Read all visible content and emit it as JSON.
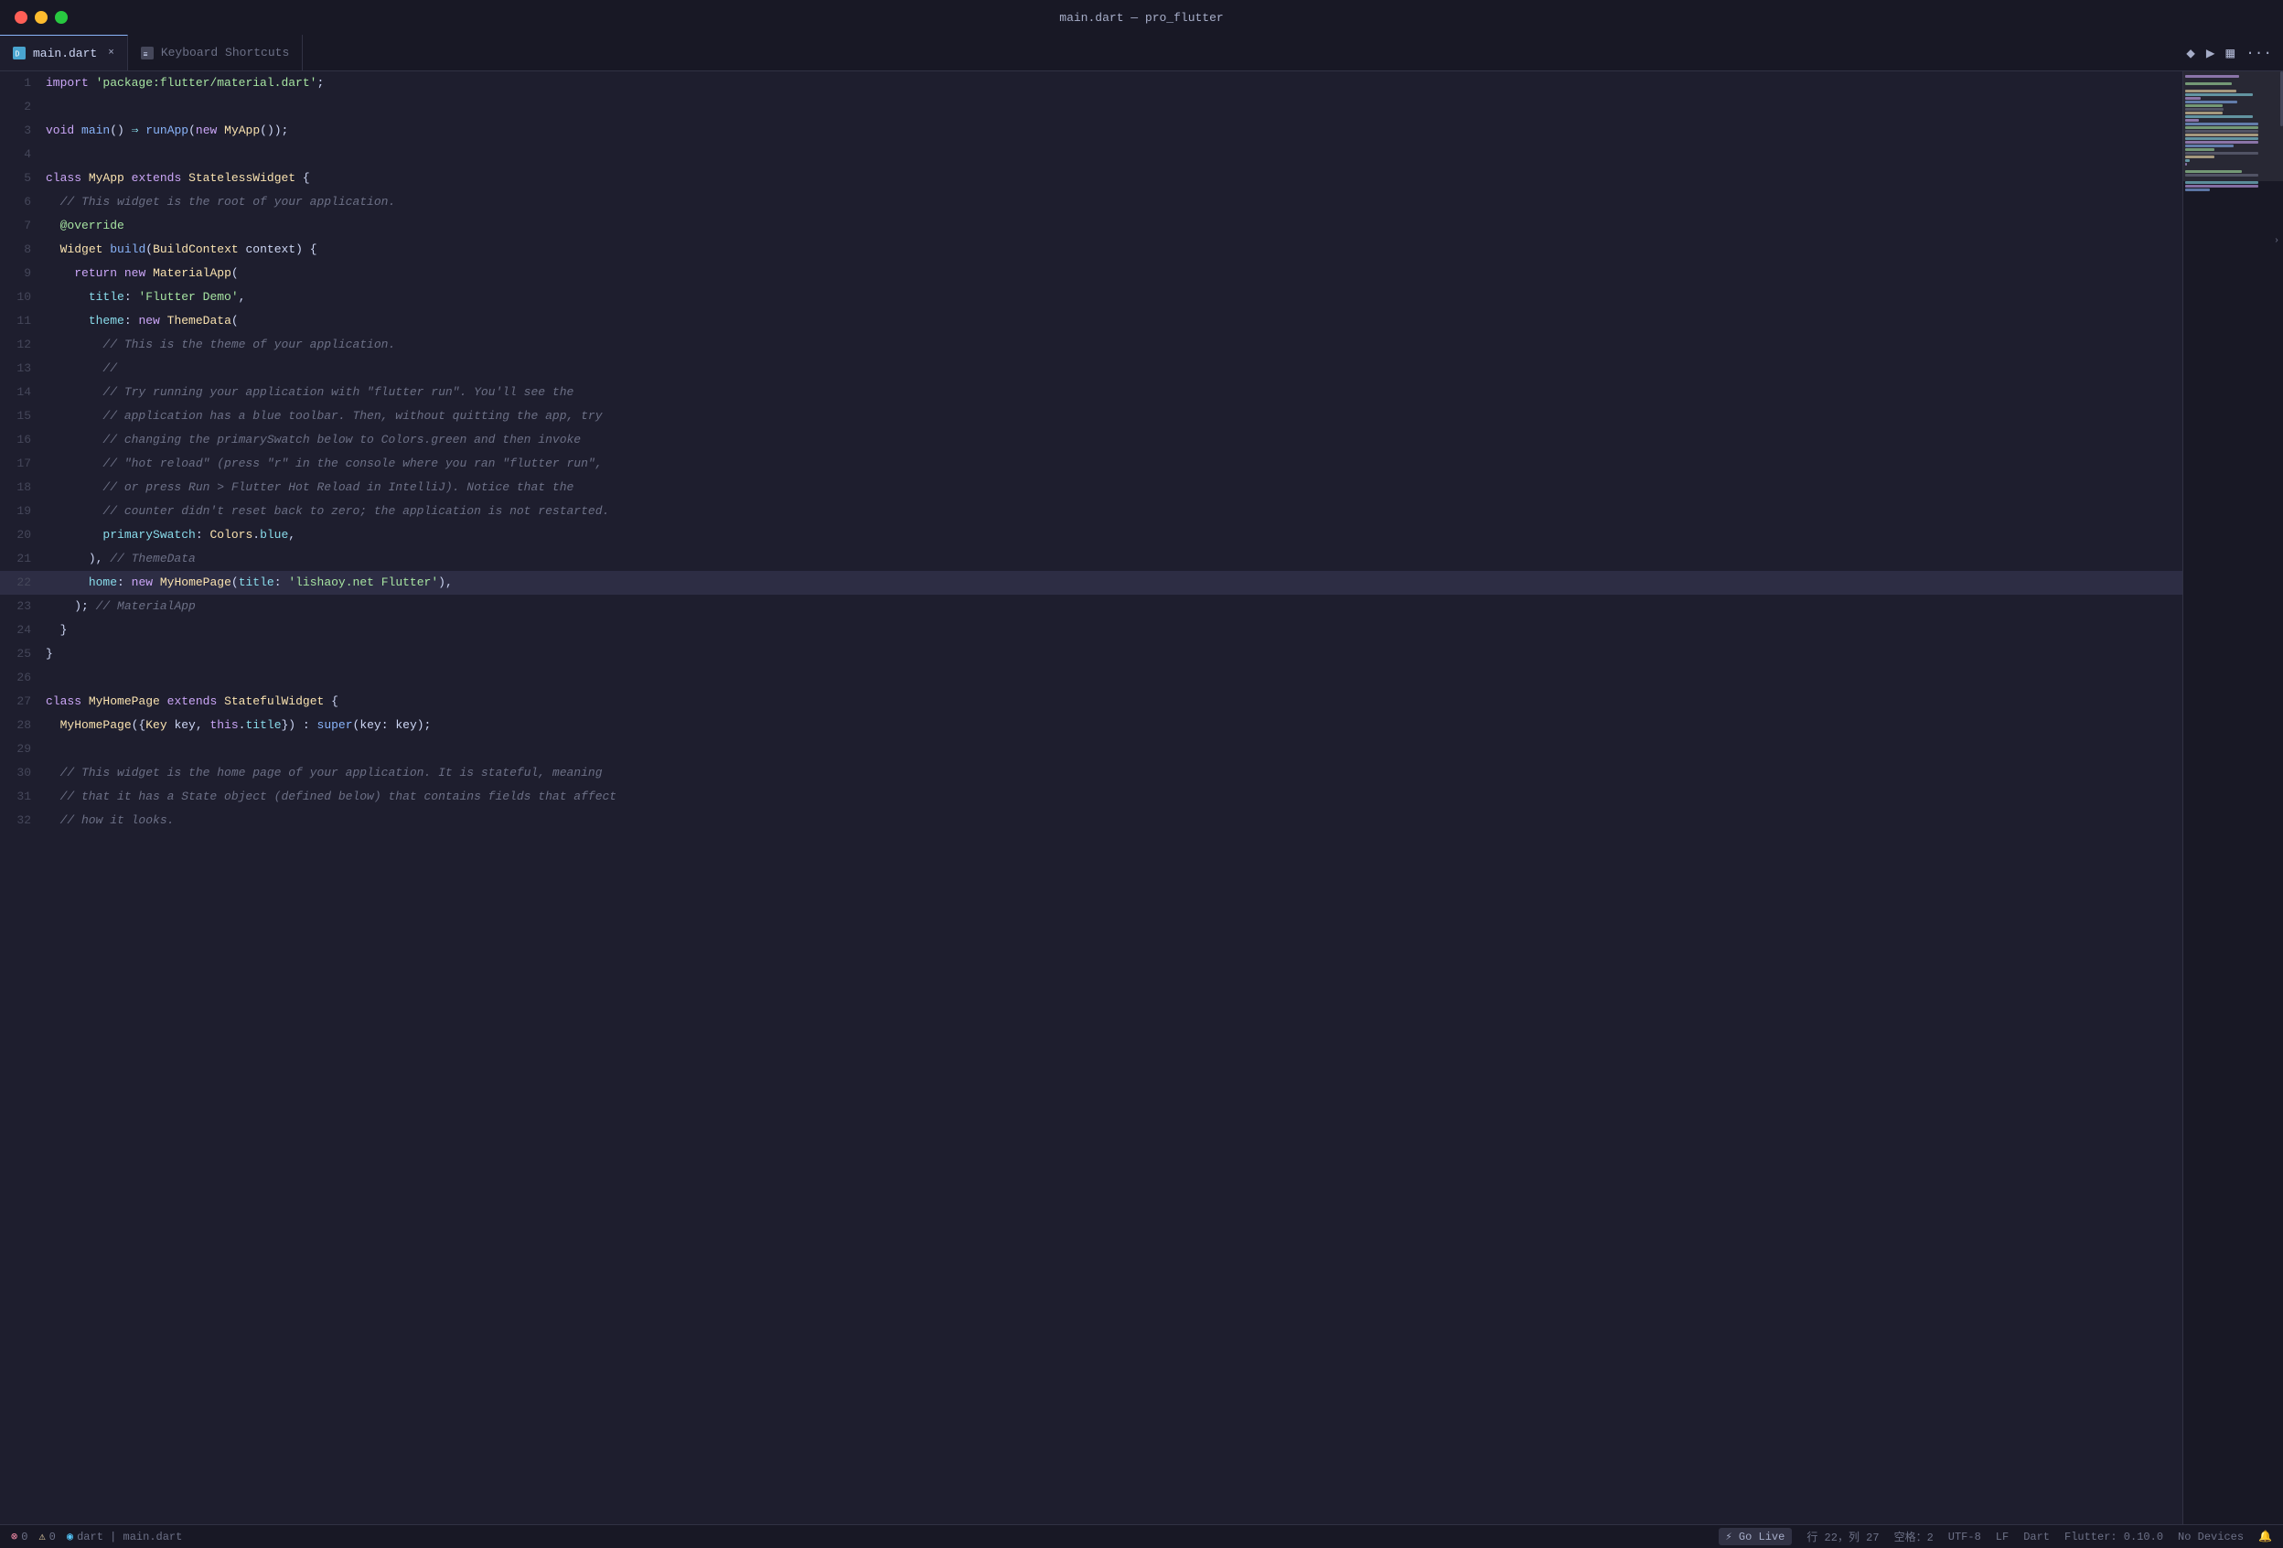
{
  "window": {
    "title": "main.dart — pro_flutter"
  },
  "tabs": [
    {
      "id": "main-dart",
      "label": "main.dart",
      "icon": "dart",
      "active": true,
      "closable": true
    },
    {
      "id": "keyboard-shortcuts",
      "label": "Keyboard Shortcuts",
      "icon": "doc",
      "active": false,
      "closable": false
    }
  ],
  "toolbar": {
    "git_icon": "◆",
    "run_icon": "▶",
    "layout_icon": "▦",
    "more_icon": "···"
  },
  "code_lines": [
    {
      "n": 1,
      "tokens": [
        {
          "t": "kw",
          "v": "import"
        },
        {
          "t": "var",
          "v": " "
        },
        {
          "t": "str",
          "v": "'package:flutter/material.dart'"
        },
        {
          "t": "punct",
          "v": ";"
        }
      ]
    },
    {
      "n": 2,
      "tokens": []
    },
    {
      "n": 3,
      "tokens": [
        {
          "t": "kw",
          "v": "void"
        },
        {
          "t": "var",
          "v": " "
        },
        {
          "t": "fn",
          "v": "main"
        },
        {
          "t": "punct",
          "v": "() "
        },
        {
          "t": "op",
          "v": "⇒"
        },
        {
          "t": "var",
          "v": " "
        },
        {
          "t": "fn",
          "v": "runApp"
        },
        {
          "t": "punct",
          "v": "("
        },
        {
          "t": "kw",
          "v": "new"
        },
        {
          "t": "var",
          "v": " "
        },
        {
          "t": "cls",
          "v": "MyApp"
        },
        {
          "t": "punct",
          "v": "());"
        }
      ]
    },
    {
      "n": 4,
      "tokens": []
    },
    {
      "n": 5,
      "tokens": [
        {
          "t": "kw",
          "v": "class"
        },
        {
          "t": "var",
          "v": " "
        },
        {
          "t": "cls",
          "v": "MyApp"
        },
        {
          "t": "var",
          "v": " "
        },
        {
          "t": "kw",
          "v": "extends"
        },
        {
          "t": "var",
          "v": " "
        },
        {
          "t": "cls",
          "v": "StatelessWidget"
        },
        {
          "t": "var",
          "v": " "
        },
        {
          "t": "punct",
          "v": "{"
        }
      ]
    },
    {
      "n": 6,
      "tokens": [
        {
          "t": "comment",
          "v": "  // This widget is the root of your application."
        }
      ]
    },
    {
      "n": 7,
      "tokens": [
        {
          "t": "decorator",
          "v": "  @override"
        }
      ]
    },
    {
      "n": 8,
      "tokens": [
        {
          "t": "var",
          "v": "  "
        },
        {
          "t": "cls",
          "v": "Widget"
        },
        {
          "t": "var",
          "v": " "
        },
        {
          "t": "fn",
          "v": "build"
        },
        {
          "t": "punct",
          "v": "("
        },
        {
          "t": "cls",
          "v": "BuildContext"
        },
        {
          "t": "var",
          "v": " context"
        },
        {
          "t": "punct",
          "v": ") {"
        }
      ]
    },
    {
      "n": 9,
      "tokens": [
        {
          "t": "var",
          "v": "    "
        },
        {
          "t": "kw",
          "v": "return"
        },
        {
          "t": "var",
          "v": " "
        },
        {
          "t": "kw",
          "v": "new"
        },
        {
          "t": "var",
          "v": " "
        },
        {
          "t": "cls",
          "v": "MaterialApp"
        },
        {
          "t": "punct",
          "v": "("
        }
      ]
    },
    {
      "n": 10,
      "tokens": [
        {
          "t": "var",
          "v": "      "
        },
        {
          "t": "prop",
          "v": "title"
        },
        {
          "t": "punct",
          "v": ": "
        },
        {
          "t": "str",
          "v": "'Flutter Demo'"
        },
        {
          "t": "punct",
          "v": ","
        }
      ]
    },
    {
      "n": 11,
      "tokens": [
        {
          "t": "var",
          "v": "      "
        },
        {
          "t": "prop",
          "v": "theme"
        },
        {
          "t": "punct",
          "v": ": "
        },
        {
          "t": "kw",
          "v": "new"
        },
        {
          "t": "var",
          "v": " "
        },
        {
          "t": "cls",
          "v": "ThemeData"
        },
        {
          "t": "punct",
          "v": "("
        }
      ]
    },
    {
      "n": 12,
      "tokens": [
        {
          "t": "comment",
          "v": "        // This is the theme of your application."
        }
      ]
    },
    {
      "n": 13,
      "tokens": [
        {
          "t": "comment",
          "v": "        //"
        }
      ]
    },
    {
      "n": 14,
      "tokens": [
        {
          "t": "comment",
          "v": "        // Try running your application with \"flutter run\". You'll see the"
        }
      ]
    },
    {
      "n": 15,
      "tokens": [
        {
          "t": "comment",
          "v": "        // application has a blue toolbar. Then, without quitting the app, try"
        }
      ]
    },
    {
      "n": 16,
      "tokens": [
        {
          "t": "comment",
          "v": "        // changing the primarySwatch below to Colors.green and then invoke"
        }
      ]
    },
    {
      "n": 17,
      "tokens": [
        {
          "t": "comment",
          "v": "        // \"hot reload\" (press \"r\" in the console where you ran \"flutter run\","
        }
      ]
    },
    {
      "n": 18,
      "tokens": [
        {
          "t": "comment",
          "v": "        // or press Run > Flutter Hot Reload in IntelliJ). Notice that the"
        }
      ]
    },
    {
      "n": 19,
      "tokens": [
        {
          "t": "comment",
          "v": "        // counter didn't reset back to zero; the application is not restarted."
        }
      ]
    },
    {
      "n": 20,
      "tokens": [
        {
          "t": "var",
          "v": "        "
        },
        {
          "t": "prop",
          "v": "primarySwatch"
        },
        {
          "t": "punct",
          "v": ": "
        },
        {
          "t": "cls",
          "v": "Colors"
        },
        {
          "t": "punct",
          "v": "."
        },
        {
          "t": "prop",
          "v": "blue"
        },
        {
          "t": "punct",
          "v": ","
        }
      ]
    },
    {
      "n": 21,
      "tokens": [
        {
          "t": "var",
          "v": "      "
        },
        {
          "t": "punct",
          "v": "), "
        },
        {
          "t": "comment",
          "v": "// ThemeData"
        }
      ]
    },
    {
      "n": 22,
      "tokens": [
        {
          "t": "var",
          "v": "      "
        },
        {
          "t": "prop",
          "v": "home"
        },
        {
          "t": "punct",
          "v": ": "
        },
        {
          "t": "kw",
          "v": "new"
        },
        {
          "t": "var",
          "v": " "
        },
        {
          "t": "cls",
          "v": "MyHomePage"
        },
        {
          "t": "punct",
          "v": "("
        },
        {
          "t": "prop",
          "v": "title"
        },
        {
          "t": "punct",
          "v": ": "
        },
        {
          "t": "str",
          "v": "'lishaoy.net Flutter'"
        },
        {
          "t": "punct",
          "v": "),"
        }
      ],
      "active": true
    },
    {
      "n": 23,
      "tokens": [
        {
          "t": "var",
          "v": "    "
        },
        {
          "t": "punct",
          "v": "); "
        },
        {
          "t": "comment",
          "v": "// MaterialApp"
        }
      ]
    },
    {
      "n": 24,
      "tokens": [
        {
          "t": "var",
          "v": "  "
        },
        {
          "t": "punct",
          "v": "}"
        }
      ]
    },
    {
      "n": 25,
      "tokens": [
        {
          "t": "punct",
          "v": "}"
        }
      ]
    },
    {
      "n": 26,
      "tokens": []
    },
    {
      "n": 27,
      "tokens": [
        {
          "t": "kw",
          "v": "class"
        },
        {
          "t": "var",
          "v": " "
        },
        {
          "t": "cls",
          "v": "MyHomePage"
        },
        {
          "t": "var",
          "v": " "
        },
        {
          "t": "kw",
          "v": "extends"
        },
        {
          "t": "var",
          "v": " "
        },
        {
          "t": "cls",
          "v": "StatefulWidget"
        },
        {
          "t": "var",
          "v": " "
        },
        {
          "t": "punct",
          "v": "{"
        }
      ]
    },
    {
      "n": 28,
      "tokens": [
        {
          "t": "var",
          "v": "  "
        },
        {
          "t": "cls",
          "v": "MyHomePage"
        },
        {
          "t": "punct",
          "v": "({"
        },
        {
          "t": "cls",
          "v": "Key"
        },
        {
          "t": "var",
          "v": " key, "
        },
        {
          "t": "kw",
          "v": "this"
        },
        {
          "t": "punct",
          "v": "."
        },
        {
          "t": "prop",
          "v": "title"
        },
        {
          "t": "punct",
          "v": "}) : "
        },
        {
          "t": "kw-blue",
          "v": "super"
        },
        {
          "t": "punct",
          "v": "(key: key);"
        }
      ]
    },
    {
      "n": 29,
      "tokens": []
    },
    {
      "n": 30,
      "tokens": [
        {
          "t": "comment",
          "v": "  // This widget is the home page of your application. It is stateful, meaning"
        }
      ]
    },
    {
      "n": 31,
      "tokens": [
        {
          "t": "comment",
          "v": "  // that it has a State object (defined below) that contains fields that affect"
        }
      ]
    },
    {
      "n": 32,
      "tokens": [
        {
          "t": "comment",
          "v": "  // how it looks."
        }
      ]
    }
  ],
  "status": {
    "errors": "0",
    "warnings": "0",
    "dart_icon": "◉",
    "branch": "dart | main.dart",
    "go_live": "⚡ Go Live",
    "position": "行 22，列 27",
    "spaces": "空格：2",
    "encoding": "UTF-8",
    "line_ending": "LF",
    "language": "Dart",
    "flutter_version": "Flutter: 0.10.0",
    "devices": "No Devices",
    "bell_icon": "🔔"
  }
}
